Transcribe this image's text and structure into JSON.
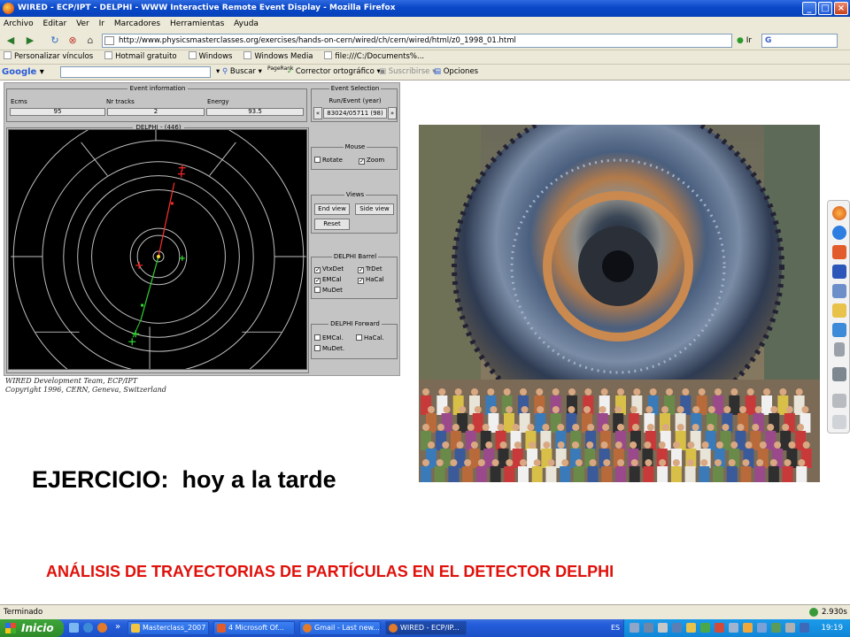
{
  "window": {
    "title": "WIRED - ECP/IPT - DELPHI - WWW Interactive Remote Event Display - Mozilla Firefox",
    "min": "_",
    "max": "□",
    "close": "×"
  },
  "menu": [
    "Archivo",
    "Editar",
    "Ver",
    "Ir",
    "Marcadores",
    "Herramientas",
    "Ayuda"
  ],
  "nav": {
    "url": "http://www.physicsmasterclasses.org/exercises/hands-on-cern/wired/ch/cern/wired/html/z0_1998_01.html",
    "go": "Ir",
    "search_logo": "G"
  },
  "bookmarks": [
    "Personalizar vínculos",
    "Hotmail gratuito",
    "Windows",
    "Windows Media",
    "file:///C:/Documents%..."
  ],
  "googlebar": {
    "logo": "Google",
    "buscar": "Buscar",
    "pagerank": "PageRank",
    "corrector": "Corrector ortográfico",
    "suscribirse": "Suscribirse",
    "opciones": "Opciones"
  },
  "applet": {
    "event_info": {
      "title": "Event information",
      "headers": [
        "Ecms",
        "Nr tracks",
        "Energy"
      ],
      "values": [
        "95",
        "2",
        "93.5"
      ]
    },
    "event_selection": {
      "title": "Event Selection",
      "label": "Run/Event  (year)",
      "prev": "«",
      "value": "83024/05711  (98)",
      "next": "»"
    },
    "display_title": "DELPHI - (446)",
    "mouse": {
      "title": "Mouse",
      "rotate": "Rotate",
      "zoom": "Zoom",
      "rotate_checked": false,
      "zoom_checked": true
    },
    "views": {
      "title": "Views",
      "end_view": "End view",
      "side_view": "Side view",
      "reset": "Reset"
    },
    "barrel": {
      "title": "DELPHI Barrel",
      "items": [
        {
          "label": "VtxDet",
          "checked": true
        },
        {
          "label": "TrDet",
          "checked": true
        },
        {
          "label": "EMCal",
          "checked": true
        },
        {
          "label": "HaCal",
          "checked": true
        },
        {
          "label": "MuDet",
          "checked": false
        }
      ]
    },
    "forward": {
      "title": "DELPHI Forward",
      "items": [
        {
          "label": "EMCal.",
          "checked": false
        },
        {
          "label": "HaCal.",
          "checked": false
        },
        {
          "label": "MuDet.",
          "checked": false
        }
      ]
    }
  },
  "credit": {
    "line1": "WIRED Development Team, ECP/IPT",
    "line2": "Copyright 1996, CERN, Geneva, Switzerland"
  },
  "headings": {
    "ejercicio": "EJERCICIO:",
    "tarde": "hoy a la tarde",
    "analisis": "ANÁLISIS DE TRAYECTORIAS DE PARTÍCULAS EN EL DETECTOR DELPHI"
  },
  "status": {
    "text": "Terminado",
    "timing": "2.930s"
  },
  "taskbar": {
    "start": "Inicio",
    "buttons": [
      "Masterclass_2007",
      "4 Microsoft Of...",
      "Gmail - Last new...",
      "WIRED - ECP/IP..."
    ],
    "lang": "ES",
    "clock": "19:19"
  },
  "colors": {
    "accent_red": "#e0100a",
    "xp_blue": "#245edb",
    "start_green": "#3ea53a"
  }
}
